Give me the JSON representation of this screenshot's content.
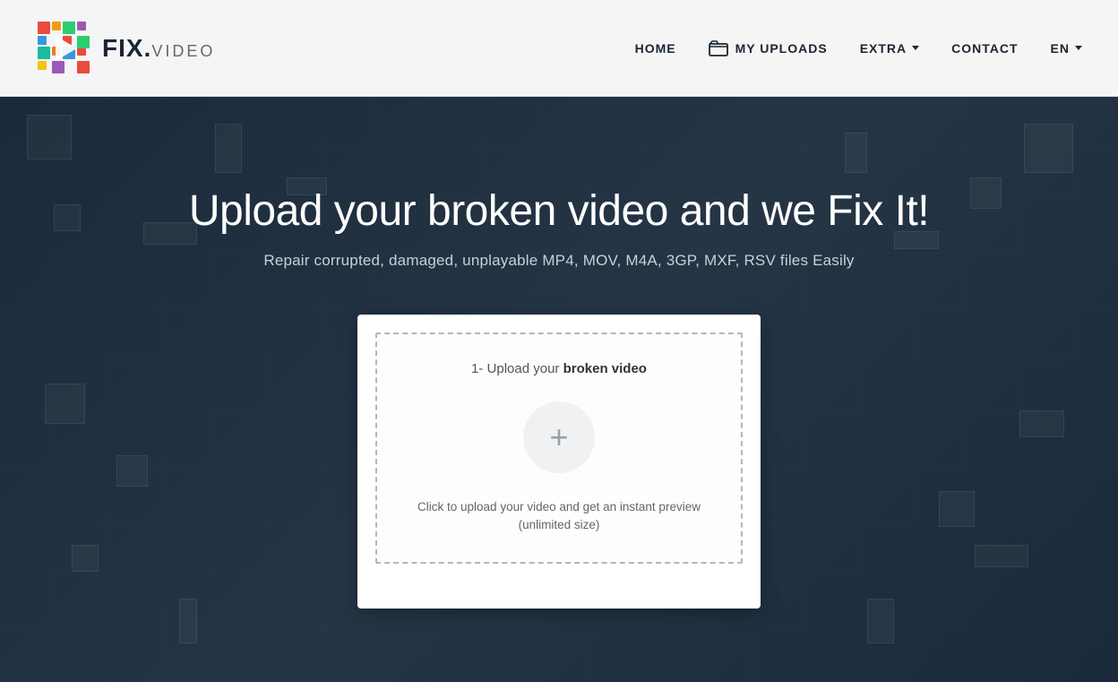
{
  "header": {
    "logo_text_fix": "FIX.",
    "logo_text_video": "VIDEO",
    "nav": {
      "home": "HOME",
      "my_uploads": "MY UPLOADS",
      "extra": "EXTRA",
      "contact": "CONTACT",
      "language": "EN"
    }
  },
  "hero": {
    "title": "Upload your broken video and we Fix It!",
    "subtitle": "Repair corrupted, damaged, unplayable MP4, MOV, M4A, 3GP, MXF, RSV files Easily",
    "upload_card": {
      "label_prefix": "1- Upload your ",
      "label_bold": "broken video",
      "hint_line1": "Click to upload your video and get an instant preview",
      "hint_line2": "(unlimited size)"
    }
  },
  "colors": {
    "header_bg": "#f5f5f5",
    "hero_bg": "#1e2d3d",
    "nav_text": "#1a2533",
    "title_color": "#ffffff",
    "subtitle_color": "#c8d0d8",
    "card_bg": "#ffffff",
    "plus_bg": "#f0f1f2",
    "plus_color": "#9aa0a6",
    "dashed_border": "#b0b8c0"
  }
}
